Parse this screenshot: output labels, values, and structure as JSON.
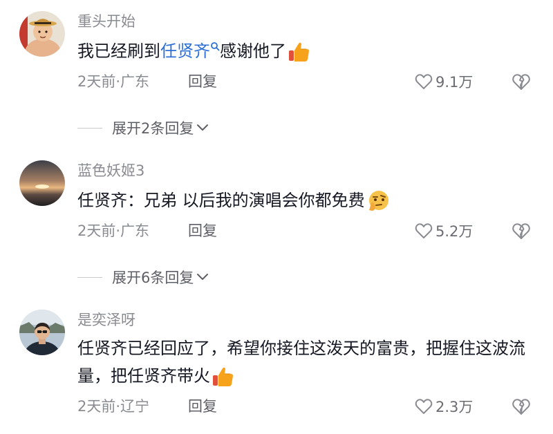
{
  "comments": [
    {
      "username": "重头开始",
      "text_before": "我已经刷到",
      "mention": "任贤齐",
      "text_after": "感谢他了",
      "emoji": "thumbs-up",
      "time_location": "2天前·广东",
      "reply_label": "回复",
      "likes": "9.1万",
      "expand_label": "展开2条回复"
    },
    {
      "username": "蓝色妖姬3",
      "text": "任贤齐：兄弟 以后我的演唱会你都免费",
      "emoji": "thinking-face",
      "time_location": "2天前·广东",
      "reply_label": "回复",
      "likes": "5.2万",
      "expand_label": "展开6条回复"
    },
    {
      "username": "是奕泽呀",
      "text": "任贤齐已经回应了，希望你接住这泼天的富贵，把握住这波流量，把任贤齐带火",
      "emoji": "thumbs-up",
      "time_location": "2天前·辽宁",
      "reply_label": "回复",
      "likes": "2.3万"
    }
  ],
  "colors": {
    "text": "#161823",
    "secondary": "#8a8b91",
    "mention": "#2b6fd6",
    "emoji": "#f7a21b"
  }
}
